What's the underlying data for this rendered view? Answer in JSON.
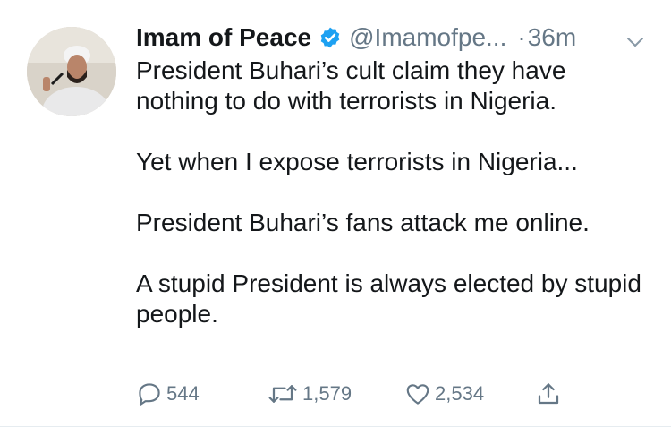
{
  "tweet": {
    "author_name": "Imam of Peace",
    "handle": "@Imamofpe...",
    "separator": "·",
    "time": "36m",
    "verified_icon": "verified-badge-icon",
    "paragraphs": [
      "President Buhari’s cult claim they have nothing to do with terrorists in Nigeria.",
      "Yet when I expose terrorists in Nigeria...",
      "President Buhari’s fans attack me online.",
      "A stupid President is always elected by stupid people."
    ],
    "actions": {
      "reply_count": "544",
      "retweet_count": "1,579",
      "like_count": "2,534"
    }
  },
  "colors": {
    "text": "#14171a",
    "secondary": "#657786",
    "verified": "#1da1f2"
  }
}
